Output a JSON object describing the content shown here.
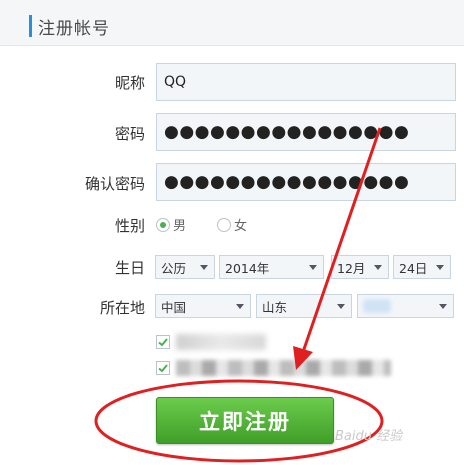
{
  "header": {
    "title": "注册帐号"
  },
  "form": {
    "nickname": {
      "label": "昵称",
      "value": "QQ"
    },
    "password": {
      "label": "密码",
      "value": "●●●●●●●●●●●●●●●●"
    },
    "confirm": {
      "label": "确认密码",
      "value": "●●●●●●●●●●●●●●●●"
    },
    "gender": {
      "label": "性别",
      "male": "男",
      "female": "女",
      "selected": "男"
    },
    "birthday": {
      "label": "生日",
      "calendar": "公历",
      "year": "2014年",
      "month": "12月",
      "day": "24日"
    },
    "location": {
      "label": "所在地",
      "country": "中国",
      "province": "山东",
      "city": ""
    },
    "agreements": [
      {
        "checked": true
      },
      {
        "checked": true
      }
    ],
    "submit_label": "立即注册"
  },
  "colors": {
    "accent": "#2a8fd6",
    "button": "#4caf50",
    "annotation": "#e02020"
  },
  "watermark": "Baidu 经验"
}
